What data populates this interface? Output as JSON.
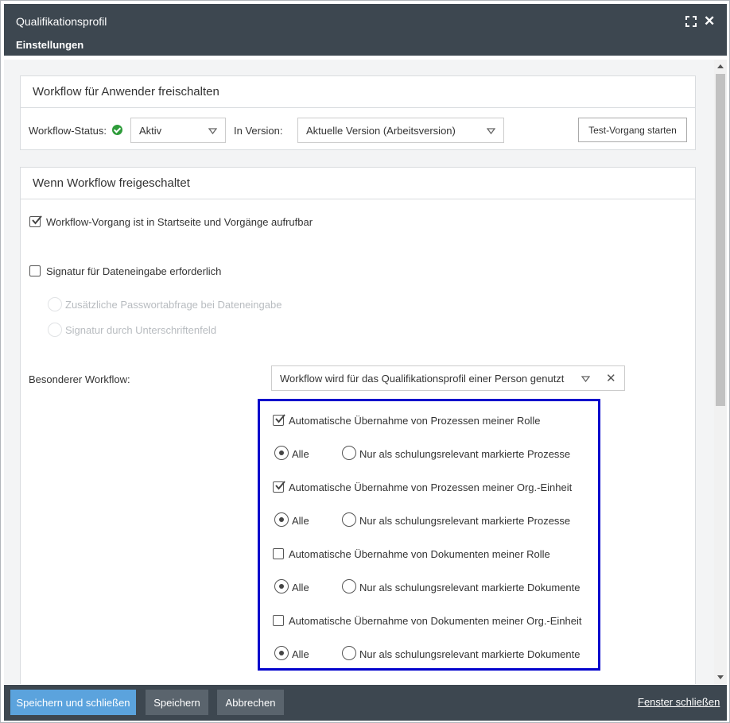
{
  "window": {
    "title": "Qualifikationsprofil",
    "subtitle": "Einstellungen"
  },
  "unlock_panel": {
    "header": "Workflow für Anwender freischalten",
    "status_label": "Workflow-Status:",
    "status_value": "Aktiv",
    "version_label": "In Version:",
    "version_value": "Aktuelle Version (Arbeitsversion)",
    "test_button": "Test-Vorgang starten"
  },
  "unlocked_panel": {
    "header": "Wenn Workflow freigeschaltet",
    "startpage_checkbox": {
      "label": "Workflow-Vorgang ist in Startseite und Vorgänge aufrufbar",
      "checked": true
    },
    "signature_checkbox": {
      "label": "Signatur für Dateneingabe erforderlich",
      "checked": false
    },
    "signature_options": [
      "Zusätzliche Passwortabfrage bei Dateneingabe",
      "Signatur durch Unterschriftenfeld"
    ],
    "special_label": "Besonderer Workflow:",
    "special_value": "Workflow wird für das Qualifikationsprofil einer Person genutzt"
  },
  "auto_options": [
    {
      "label": "Automatische Übernahme von Prozessen meiner Rolle",
      "checked": true,
      "radio_all": "Alle",
      "radio_marked": "Nur als schulungsrelevant markierte Prozesse"
    },
    {
      "label": "Automatische Übernahme von Prozessen meiner Org.-Einheit",
      "checked": true,
      "radio_all": "Alle",
      "radio_marked": "Nur als schulungsrelevant markierte Prozesse"
    },
    {
      "label": "Automatische Übernahme von Dokumenten meiner Rolle",
      "checked": false,
      "radio_all": "Alle",
      "radio_marked": "Nur als schulungsrelevant markierte Dokumente"
    },
    {
      "label": "Automatische Übernahme von Dokumenten meiner Org.-Einheit",
      "checked": false,
      "radio_all": "Alle",
      "radio_marked": "Nur als schulungsrelevant markierte Dokumente"
    }
  ],
  "footer": {
    "save_close": "Speichern und schließen",
    "save": "Speichern",
    "cancel": "Abbrechen",
    "close_window": "Fenster schließen"
  },
  "colors": {
    "titlebar": "#3d4750",
    "primary_button": "#5ba3dd",
    "highlight_border": "#0000cc",
    "status_ok": "#2e9c3a"
  }
}
